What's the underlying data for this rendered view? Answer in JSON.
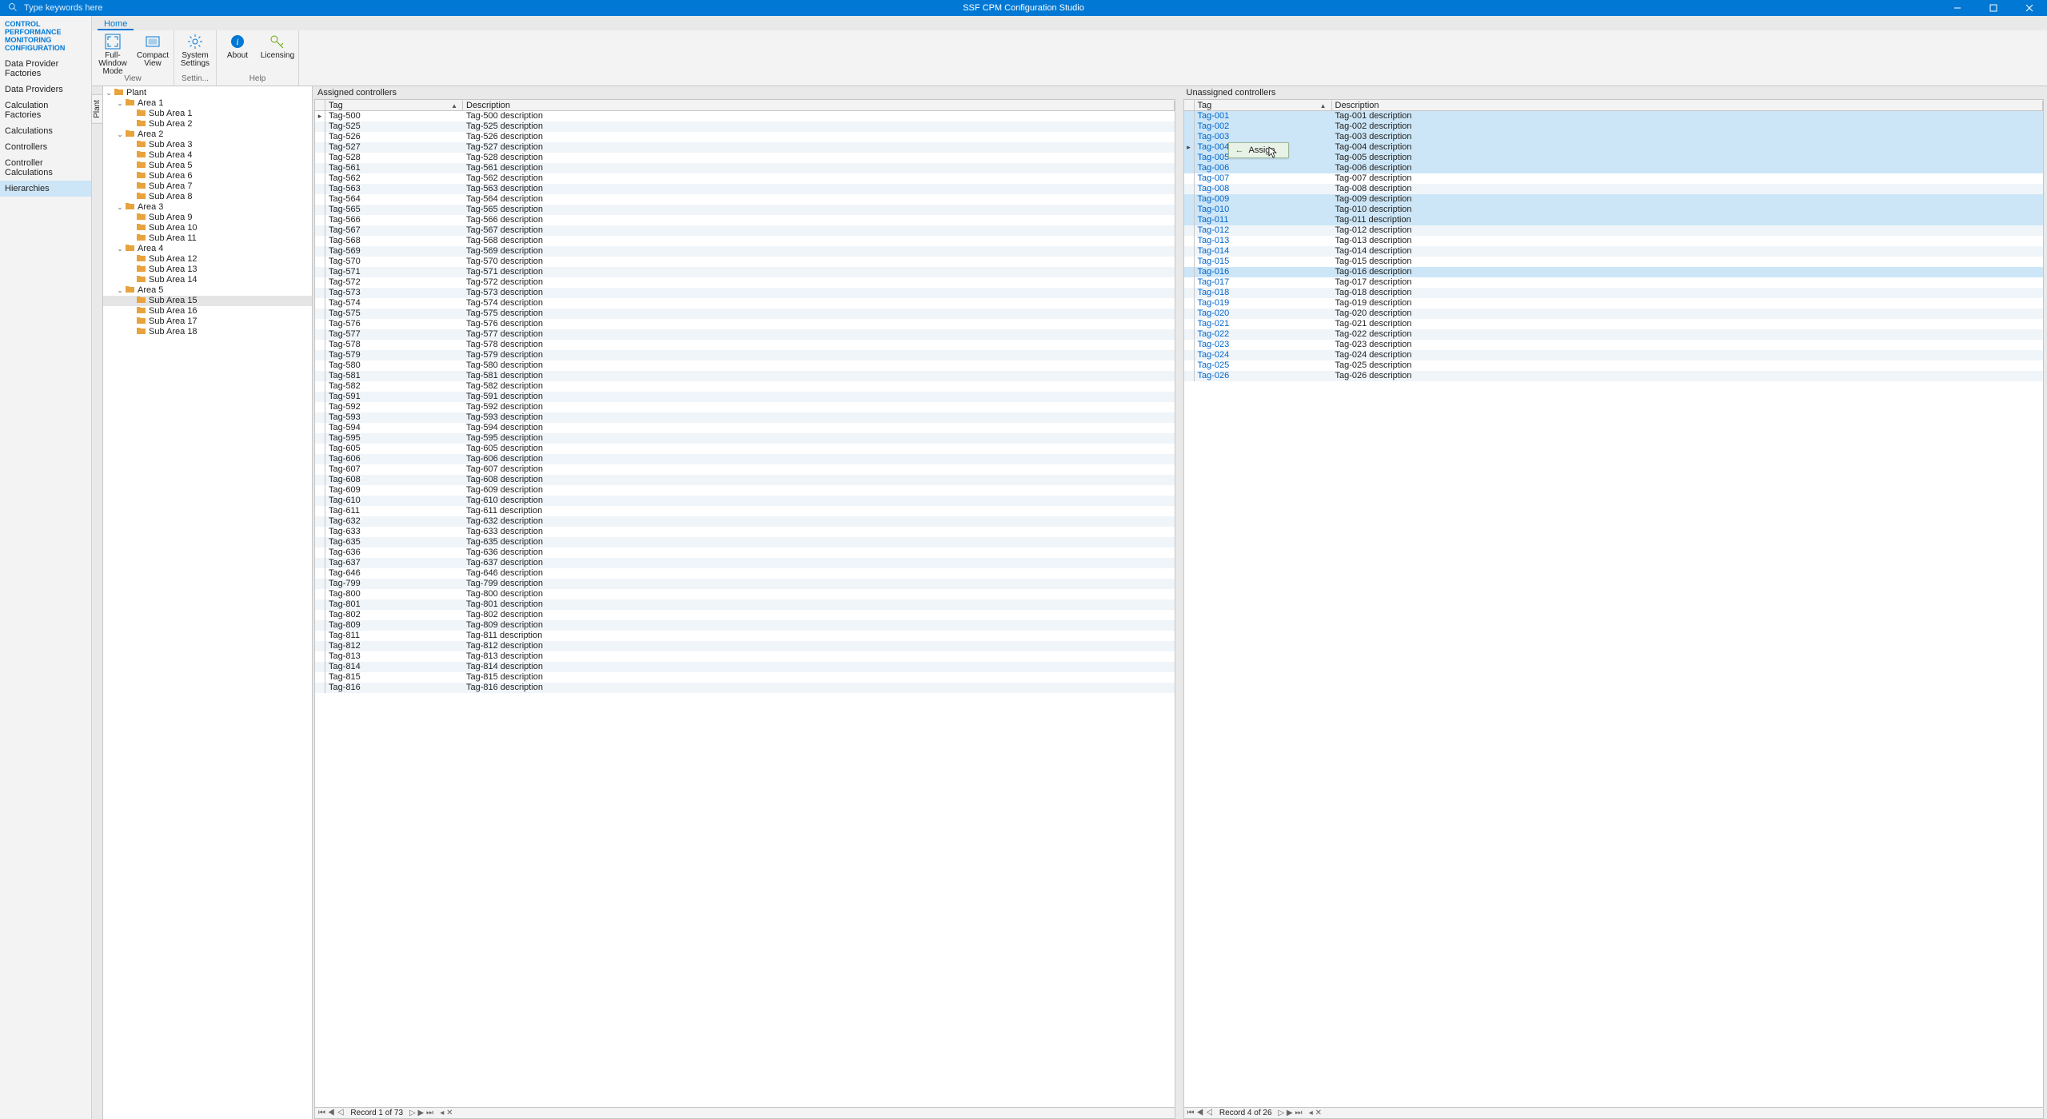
{
  "app": {
    "title": "SSF CPM Configuration Studio",
    "search_placeholder": "Type keywords here"
  },
  "nav": {
    "heading": "CONTROL PERFORMANCE MONITORING CONFIGURATION",
    "items": [
      "Data Provider Factories",
      "Data Providers",
      "Calculation Factories",
      "Calculations",
      "Controllers",
      "Controller Calculations",
      "Hierarchies"
    ],
    "selected_index": 6
  },
  "tab": {
    "home": "Home"
  },
  "ribbon": {
    "view_group": "View",
    "settings_group": "Settin...",
    "help_group": "Help",
    "full_window": "Full-Window Mode",
    "compact_view": "Compact View",
    "system_settings": "System Settings",
    "about": "About",
    "licensing": "Licensing"
  },
  "vtab": {
    "label": "Plant"
  },
  "tree": [
    {
      "lvl": 0,
      "exp": true,
      "label": "Plant"
    },
    {
      "lvl": 1,
      "exp": true,
      "label": "Area 1"
    },
    {
      "lvl": 2,
      "label": "Sub Area 1"
    },
    {
      "lvl": 2,
      "label": "Sub Area 2"
    },
    {
      "lvl": 1,
      "exp": true,
      "label": "Area 2"
    },
    {
      "lvl": 2,
      "label": "Sub Area 3"
    },
    {
      "lvl": 2,
      "label": "Sub Area 4"
    },
    {
      "lvl": 2,
      "label": "Sub Area 5"
    },
    {
      "lvl": 2,
      "label": "Sub Area 6"
    },
    {
      "lvl": 2,
      "label": "Sub Area 7"
    },
    {
      "lvl": 2,
      "label": "Sub Area 8"
    },
    {
      "lvl": 1,
      "exp": true,
      "label": "Area 3"
    },
    {
      "lvl": 2,
      "label": "Sub Area 9"
    },
    {
      "lvl": 2,
      "label": "Sub Area 10"
    },
    {
      "lvl": 2,
      "label": "Sub Area 11"
    },
    {
      "lvl": 1,
      "exp": true,
      "label": "Area 4"
    },
    {
      "lvl": 2,
      "label": "Sub Area 12"
    },
    {
      "lvl": 2,
      "label": "Sub Area 13"
    },
    {
      "lvl": 2,
      "label": "Sub Area 14"
    },
    {
      "lvl": 1,
      "exp": true,
      "label": "Area 5"
    },
    {
      "lvl": 2,
      "label": "Sub Area 15",
      "sel": true
    },
    {
      "lvl": 2,
      "label": "Sub Area 16"
    },
    {
      "lvl": 2,
      "label": "Sub Area 17"
    },
    {
      "lvl": 2,
      "label": "Sub Area 18"
    }
  ],
  "grids": {
    "tag_col": "Tag",
    "desc_col": "Description",
    "assigned": {
      "title": "Assigned controllers",
      "record_text": "Record 1 of 73",
      "current_index": 0,
      "rows": [
        {
          "tag": "Tag-500",
          "desc": "Tag-500 description"
        },
        {
          "tag": "Tag-525",
          "desc": "Tag-525 description"
        },
        {
          "tag": "Tag-526",
          "desc": "Tag-526 description"
        },
        {
          "tag": "Tag-527",
          "desc": "Tag-527 description"
        },
        {
          "tag": "Tag-528",
          "desc": "Tag-528 description"
        },
        {
          "tag": "Tag-561",
          "desc": "Tag-561 description"
        },
        {
          "tag": "Tag-562",
          "desc": "Tag-562 description"
        },
        {
          "tag": "Tag-563",
          "desc": "Tag-563 description"
        },
        {
          "tag": "Tag-564",
          "desc": "Tag-564 description"
        },
        {
          "tag": "Tag-565",
          "desc": "Tag-565 description"
        },
        {
          "tag": "Tag-566",
          "desc": "Tag-566 description"
        },
        {
          "tag": "Tag-567",
          "desc": "Tag-567 description"
        },
        {
          "tag": "Tag-568",
          "desc": "Tag-568 description"
        },
        {
          "tag": "Tag-569",
          "desc": "Tag-569 description"
        },
        {
          "tag": "Tag-570",
          "desc": "Tag-570 description"
        },
        {
          "tag": "Tag-571",
          "desc": "Tag-571 description"
        },
        {
          "tag": "Tag-572",
          "desc": "Tag-572 description"
        },
        {
          "tag": "Tag-573",
          "desc": "Tag-573 description"
        },
        {
          "tag": "Tag-574",
          "desc": "Tag-574 description"
        },
        {
          "tag": "Tag-575",
          "desc": "Tag-575 description"
        },
        {
          "tag": "Tag-576",
          "desc": "Tag-576 description"
        },
        {
          "tag": "Tag-577",
          "desc": "Tag-577 description"
        },
        {
          "tag": "Tag-578",
          "desc": "Tag-578 description"
        },
        {
          "tag": "Tag-579",
          "desc": "Tag-579 description"
        },
        {
          "tag": "Tag-580",
          "desc": "Tag-580 description"
        },
        {
          "tag": "Tag-581",
          "desc": "Tag-581 description"
        },
        {
          "tag": "Tag-582",
          "desc": "Tag-582 description"
        },
        {
          "tag": "Tag-591",
          "desc": "Tag-591 description"
        },
        {
          "tag": "Tag-592",
          "desc": "Tag-592 description"
        },
        {
          "tag": "Tag-593",
          "desc": "Tag-593 description"
        },
        {
          "tag": "Tag-594",
          "desc": "Tag-594 description"
        },
        {
          "tag": "Tag-595",
          "desc": "Tag-595 description"
        },
        {
          "tag": "Tag-605",
          "desc": "Tag-605 description"
        },
        {
          "tag": "Tag-606",
          "desc": "Tag-606 description"
        },
        {
          "tag": "Tag-607",
          "desc": "Tag-607 description"
        },
        {
          "tag": "Tag-608",
          "desc": "Tag-608 description"
        },
        {
          "tag": "Tag-609",
          "desc": "Tag-609 description"
        },
        {
          "tag": "Tag-610",
          "desc": "Tag-610 description"
        },
        {
          "tag": "Tag-611",
          "desc": "Tag-611 description"
        },
        {
          "tag": "Tag-632",
          "desc": "Tag-632 description"
        },
        {
          "tag": "Tag-633",
          "desc": "Tag-633 description"
        },
        {
          "tag": "Tag-635",
          "desc": "Tag-635 description"
        },
        {
          "tag": "Tag-636",
          "desc": "Tag-636 description"
        },
        {
          "tag": "Tag-637",
          "desc": "Tag-637 description"
        },
        {
          "tag": "Tag-646",
          "desc": "Tag-646 description"
        },
        {
          "tag": "Tag-799",
          "desc": "Tag-799 description"
        },
        {
          "tag": "Tag-800",
          "desc": "Tag-800 description"
        },
        {
          "tag": "Tag-801",
          "desc": "Tag-801 description"
        },
        {
          "tag": "Tag-802",
          "desc": "Tag-802 description"
        },
        {
          "tag": "Tag-809",
          "desc": "Tag-809 description"
        },
        {
          "tag": "Tag-811",
          "desc": "Tag-811 description"
        },
        {
          "tag": "Tag-812",
          "desc": "Tag-812 description"
        },
        {
          "tag": "Tag-813",
          "desc": "Tag-813 description"
        },
        {
          "tag": "Tag-814",
          "desc": "Tag-814 description"
        },
        {
          "tag": "Tag-815",
          "desc": "Tag-815 description"
        },
        {
          "tag": "Tag-816",
          "desc": "Tag-816 description"
        }
      ]
    },
    "unassigned": {
      "title": "Unassigned controllers",
      "record_text": "Record 4 of 26",
      "current_index": 3,
      "selected": [
        0,
        1,
        2,
        3,
        4,
        5,
        8,
        9,
        10,
        15
      ],
      "rows": [
        {
          "tag": "Tag-001",
          "desc": "Tag-001 description"
        },
        {
          "tag": "Tag-002",
          "desc": "Tag-002 description"
        },
        {
          "tag": "Tag-003",
          "desc": "Tag-003 description"
        },
        {
          "tag": "Tag-004",
          "desc": "Tag-004 description"
        },
        {
          "tag": "Tag-005",
          "desc": "Tag-005 description"
        },
        {
          "tag": "Tag-006",
          "desc": "Tag-006 description"
        },
        {
          "tag": "Tag-007",
          "desc": "Tag-007 description"
        },
        {
          "tag": "Tag-008",
          "desc": "Tag-008 description"
        },
        {
          "tag": "Tag-009",
          "desc": "Tag-009 description"
        },
        {
          "tag": "Tag-010",
          "desc": "Tag-010 description"
        },
        {
          "tag": "Tag-011",
          "desc": "Tag-011 description"
        },
        {
          "tag": "Tag-012",
          "desc": "Tag-012 description"
        },
        {
          "tag": "Tag-013",
          "desc": "Tag-013 description"
        },
        {
          "tag": "Tag-014",
          "desc": "Tag-014 description"
        },
        {
          "tag": "Tag-015",
          "desc": "Tag-015 description"
        },
        {
          "tag": "Tag-016",
          "desc": "Tag-016 description"
        },
        {
          "tag": "Tag-017",
          "desc": "Tag-017 description"
        },
        {
          "tag": "Tag-018",
          "desc": "Tag-018 description"
        },
        {
          "tag": "Tag-019",
          "desc": "Tag-019 description"
        },
        {
          "tag": "Tag-020",
          "desc": "Tag-020 description"
        },
        {
          "tag": "Tag-021",
          "desc": "Tag-021 description"
        },
        {
          "tag": "Tag-022",
          "desc": "Tag-022 description"
        },
        {
          "tag": "Tag-023",
          "desc": "Tag-023 description"
        },
        {
          "tag": "Tag-024",
          "desc": "Tag-024 description"
        },
        {
          "tag": "Tag-025",
          "desc": "Tag-025 description"
        },
        {
          "tag": "Tag-026",
          "desc": "Tag-026 description"
        }
      ]
    }
  },
  "context": {
    "assign_label": "Assign"
  },
  "colors": {
    "accent": "#0078d4",
    "selection": "#cde6f7",
    "folder": "#e8a33d"
  }
}
